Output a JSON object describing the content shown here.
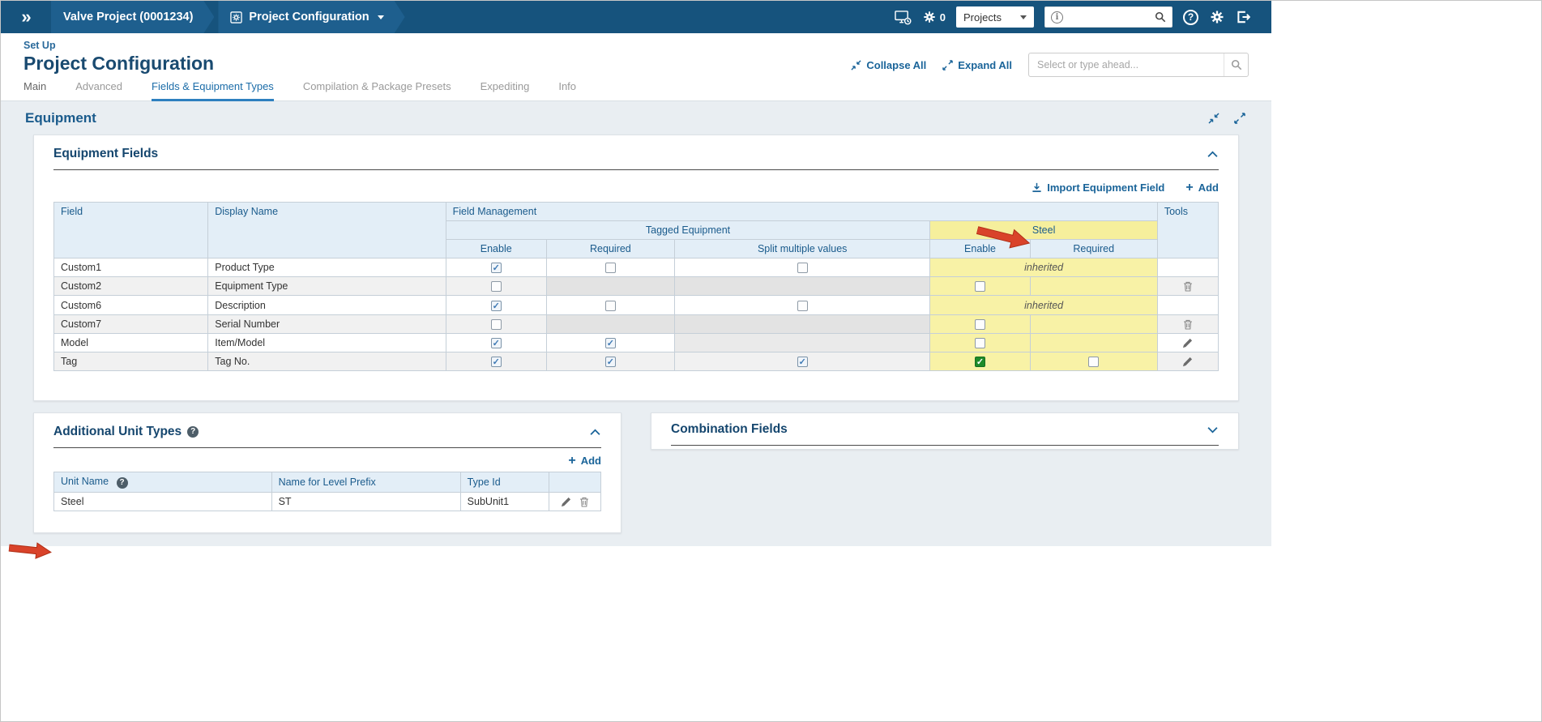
{
  "topbar": {
    "breadcrumb_project": "Valve Project (0001234)",
    "breadcrumb_config": "Project Configuration",
    "gear_count": "0",
    "scope_select_value": "Projects"
  },
  "header": {
    "kicker": "Set Up",
    "title": "Project Configuration",
    "collapse_all_label": "Collapse All",
    "expand_all_label": "Expand All",
    "typeahead_placeholder": "Select or type ahead...",
    "tabs": [
      {
        "label": "Main"
      },
      {
        "label": "Advanced"
      },
      {
        "label": "Fields & Equipment Types"
      },
      {
        "label": "Compilation & Package Presets"
      },
      {
        "label": "Expediting"
      },
      {
        "label": "Info"
      }
    ]
  },
  "equipment": {
    "section_title": "Equipment",
    "fields_card": {
      "title": "Equipment Fields",
      "import_label": "Import Equipment Field",
      "add_label": "Add",
      "headers": {
        "field": "Field",
        "display_name": "Display Name",
        "field_management": "Field Management",
        "tagged_equipment": "Tagged Equipment",
        "steel_group": "Steel",
        "enable": "Enable",
        "required": "Required",
        "split": "Split multiple values",
        "steel_enable": "Enable",
        "steel_required": "Required",
        "tools": "Tools"
      },
      "rows": [
        {
          "field": "Custom1",
          "display_name": "Product Type",
          "tagged_enable": "checked",
          "tagged_required": "unchecked",
          "tagged_split": "unchecked",
          "steel_state": "inherited",
          "steel_text": "inherited",
          "tool": ""
        },
        {
          "field": "Custom2",
          "display_name": "Equipment Type",
          "tagged_enable": "unchecked",
          "tagged_required": "none",
          "tagged_split": "none",
          "steel_enable": "unchecked",
          "steel_required": "none",
          "tool": "trash"
        },
        {
          "field": "Custom6",
          "display_name": "Description",
          "tagged_enable": "checked",
          "tagged_required": "unchecked",
          "tagged_split": "unchecked",
          "steel_state": "inherited",
          "steel_text": "inherited",
          "tool": ""
        },
        {
          "field": "Custom7",
          "display_name": "Serial Number",
          "tagged_enable": "unchecked",
          "tagged_required": "none",
          "tagged_split": "none",
          "steel_enable": "unchecked",
          "steel_required": "none",
          "tool": "trash"
        },
        {
          "field": "Model",
          "display_name": "Item/Model",
          "tagged_enable": "checked",
          "tagged_required": "checked",
          "tagged_split": "none",
          "steel_enable": "unchecked",
          "steel_required": "none",
          "tool": "pencil"
        },
        {
          "field": "Tag",
          "display_name": "Tag No.",
          "tagged_enable": "checked",
          "tagged_required": "checked",
          "tagged_split": "checked",
          "steel_enable": "checked-green",
          "steel_required": "unchecked",
          "tool": "pencil"
        }
      ]
    },
    "unit_types_card": {
      "title": "Additional Unit Types",
      "add_label": "Add",
      "headers": {
        "unit_name": "Unit Name",
        "level_prefix": "Name for Level Prefix",
        "type_id": "Type Id"
      },
      "rows": [
        {
          "unit_name": "Steel",
          "level_prefix": "ST",
          "type_id": "SubUnit1"
        }
      ]
    },
    "combination_card": {
      "title": "Combination Fields"
    }
  },
  "colors": {
    "navbar_blue": "#16537D",
    "highlight_yellow": "#F8F2A6",
    "link_blue": "#1A6499",
    "annotation_red": "#D9432A"
  }
}
